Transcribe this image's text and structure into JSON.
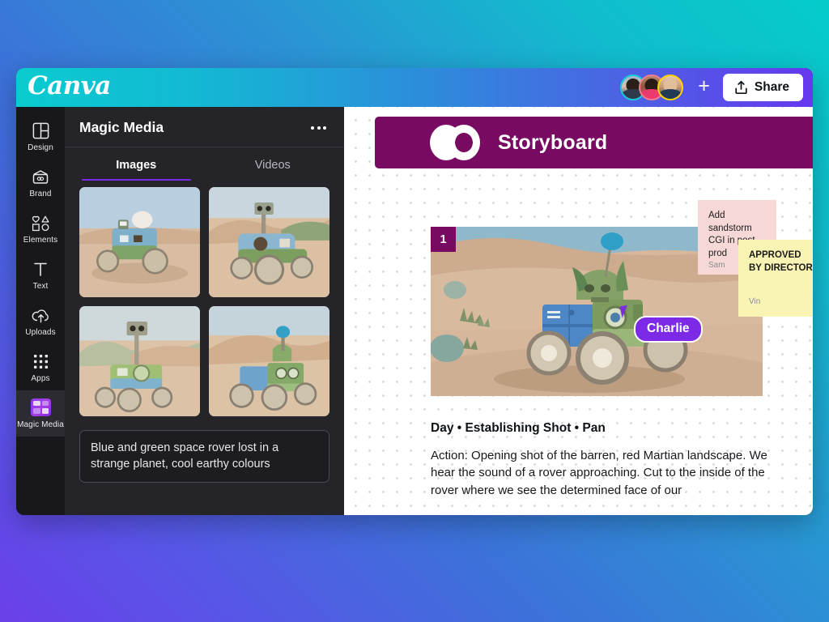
{
  "app": {
    "logo_text": "Canva",
    "share_label": "Share",
    "add_people_label": "+"
  },
  "collaborators": [
    {
      "name": "Collaborator 1"
    },
    {
      "name": "Collaborator 2"
    },
    {
      "name": "Collaborator 3"
    }
  ],
  "rail": {
    "items": [
      {
        "label": "Design",
        "icon": "layout-icon",
        "active": false
      },
      {
        "label": "Brand",
        "icon": "brand-kit-icon",
        "active": false
      },
      {
        "label": "Elements",
        "icon": "shapes-icon",
        "active": false
      },
      {
        "label": "Text",
        "icon": "text-t-icon",
        "active": false
      },
      {
        "label": "Uploads",
        "icon": "upload-cloud-icon",
        "active": false
      },
      {
        "label": "Apps",
        "icon": "grid-dots-icon",
        "active": false
      },
      {
        "label": "Magic Media",
        "icon": "magic-media-icon",
        "active": true
      }
    ]
  },
  "panel": {
    "title": "Magic Media",
    "more_label": "•••",
    "tabs": [
      {
        "label": "Images",
        "active": true
      },
      {
        "label": "Videos",
        "active": false
      }
    ],
    "thumbnails": [
      {
        "alt": "Blue and green space rover on desert dunes, antenna dish"
      },
      {
        "alt": "Blue and green rover with camera mast on sand"
      },
      {
        "alt": "Green rover with tall camera mast on dunes"
      },
      {
        "alt": "Blue and green rover with antenna facing right"
      }
    ],
    "prompt": "Blue and green space rover lost in a strange planet, cool earthy colours"
  },
  "canvas": {
    "header_title": "Storyboard",
    "header_logo": "two-circles-logo",
    "header_color": "#780A62",
    "scene": {
      "number": "1",
      "image_alt": "Green and blue space rover driving across red Martian desert",
      "heading": "Day • Establishing Shot • Pan",
      "body": "Action: Opening shot of the barren, red Martian landscape. We hear the sound of a rover approaching. Cut to the inside of the rover where we see the determined face of our"
    },
    "cursor": {
      "label": "Charlie",
      "color": "#7D2AE8"
    },
    "notes": [
      {
        "body": "Add sandstorm CGI in post prod",
        "author": "Sam",
        "color": "#F6D9D6"
      },
      {
        "body": "APPROVED BY DIRECTOR",
        "author": "Vin",
        "color": "#FAF4B4"
      }
    ]
  }
}
